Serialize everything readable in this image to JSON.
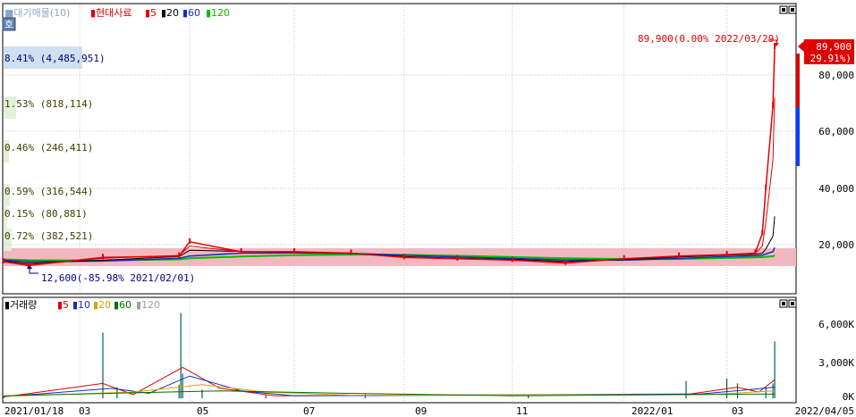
{
  "price_panel": {
    "legend": [
      {
        "label": "■대기매물(10)",
        "color": "#8fa8c8"
      },
      {
        "label": "▮현대사료",
        "color": "#e00000"
      },
      {
        "label": "▮5",
        "color": "#e00000"
      },
      {
        "label": "▮20",
        "color": "#000000"
      },
      {
        "label": "▮60",
        "color": "#1030c0"
      },
      {
        "label": "▮120",
        "color": "#00c000"
      }
    ],
    "toggle_label": "호",
    "supply_labels": [
      "8.41% (4,485,951)",
      "1.53% (818,114)",
      "0.46% (246,411)",
      "0.59% (316,544)",
      "0.15% (80,881)",
      "0.72% (382,521)"
    ],
    "high_annotation": "89,900(0.00% 2022/03/29)",
    "low_annotation": "12,600(-85.98% 2021/02/01)",
    "current_price": "89,900",
    "current_change": "( 29.91%)",
    "y_ticks": [
      "80,000",
      "60,000",
      "40,000",
      "20,000"
    ],
    "colors": {
      "up": "#e00000",
      "down": "#0040ff",
      "band": "#f2b8c0",
      "badge": "#e00000"
    }
  },
  "volume_panel": {
    "legend": [
      {
        "label": "▮거래량",
        "color": "#000000"
      },
      {
        "label": "▮5",
        "color": "#e00000"
      },
      {
        "label": "▮10",
        "color": "#1030c0"
      },
      {
        "label": "▮20",
        "color": "#e0a000"
      },
      {
        "label": "▮60",
        "color": "#007000"
      },
      {
        "label": "▮120",
        "color": "#a0a0a0"
      }
    ],
    "y_ticks": [
      "6,000K",
      "3,000K",
      "0K"
    ]
  },
  "x_axis": {
    "labels": [
      "2021/01/18",
      "03",
      "05",
      "07",
      "09",
      "11",
      "2022/01",
      "03",
      "2022/04/05"
    ]
  },
  "chart_data": [
    {
      "type": "line",
      "title": "현대사료",
      "ylim": [
        8000,
        95000
      ],
      "x": [
        "2021/01/18",
        "2021/02/01",
        "2021/03/15",
        "2021/04/27",
        "2021/05/03",
        "2021/06/01",
        "2021/07/01",
        "2021/08/02",
        "2021/09/01",
        "2021/10/01",
        "2021/11/01",
        "2021/12/01",
        "2022/01/03",
        "2022/02/03",
        "2022/03/02",
        "2022/03/18",
        "2022/03/22",
        "2022/03/24",
        "2022/03/28",
        "2022/03/29"
      ],
      "series": [
        {
          "name": "현대사료",
          "values": [
            14000,
            12600,
            15500,
            16000,
            21000,
            17500,
            17500,
            17000,
            15500,
            15000,
            14500,
            13500,
            15000,
            16000,
            16500,
            17000,
            24000,
            40000,
            69000,
            89900
          ]
        },
        {
          "name": "5",
          "values": [
            14000,
            13000,
            15200,
            16200,
            19500,
            17500,
            17400,
            17000,
            15600,
            15100,
            14600,
            13700,
            14900,
            15900,
            16400,
            16900,
            19500,
            28000,
            50000,
            72000
          ]
        },
        {
          "name": "20",
          "values": [
            14200,
            13400,
            14500,
            15800,
            18000,
            17600,
            17300,
            17000,
            15800,
            15200,
            14800,
            14100,
            14700,
            15600,
            16300,
            16600,
            17000,
            18500,
            23000,
            30000
          ]
        },
        {
          "name": "60",
          "values": [
            14500,
            14000,
            14200,
            15200,
            16000,
            17000,
            17100,
            16900,
            16300,
            15600,
            15100,
            14600,
            14500,
            15100,
            15800,
            16100,
            16300,
            16700,
            17500,
            19000
          ]
        },
        {
          "name": "120",
          "values": [
            14800,
            14500,
            14400,
            14800,
            15200,
            15800,
            16300,
            16500,
            16400,
            16100,
            15600,
            15200,
            14900,
            14900,
            15300,
            15500,
            15600,
            15700,
            15900,
            16200
          ]
        }
      ]
    },
    {
      "type": "bar",
      "title": "거래량",
      "ylim": [
        0,
        7000
      ],
      "x": [
        "2021/01/18",
        "2021/03/15",
        "2021/03/23",
        "2021/04/27",
        "2021/04/28",
        "2021/04/29",
        "2021/05/10",
        "2021/06/15",
        "2021/08/10",
        "2021/11/10",
        "2022/02/07",
        "2022/03/02",
        "2022/03/08",
        "2022/03/24",
        "2022/03/28",
        "2022/03/29"
      ],
      "values": [
        150,
        5300,
        900,
        1100,
        6900,
        2000,
        700,
        300,
        400,
        300,
        1400,
        1600,
        1200,
        800,
        1200,
        4600
      ]
    }
  ]
}
